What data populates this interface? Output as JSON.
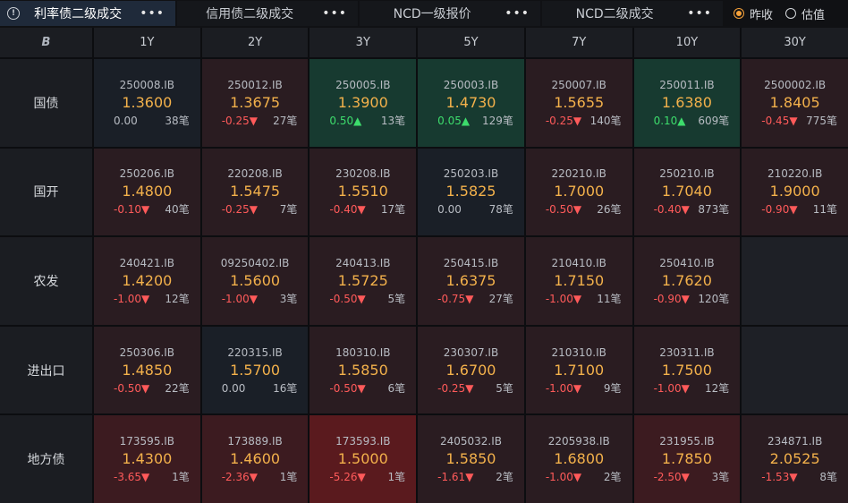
{
  "tabs": [
    {
      "label": "利率债二级成交",
      "active": true,
      "width": 196
    },
    {
      "label": "信用债二级成交",
      "active": false,
      "width": 202
    },
    {
      "label": "NCD一级报价",
      "active": false,
      "width": 202
    },
    {
      "label": "NCD二级成交",
      "active": false,
      "width": 202
    }
  ],
  "more_glyph": "•••",
  "corner_icon": "B",
  "radios": [
    {
      "label": "昨收",
      "checked": true
    },
    {
      "label": "估值",
      "checked": false
    }
  ],
  "columns": [
    "1Y",
    "2Y",
    "3Y",
    "5Y",
    "7Y",
    "10Y",
    "30Y"
  ],
  "rows": [
    {
      "label": "国债",
      "cells": [
        {
          "code": "250008.IB",
          "yield": "1.3600",
          "change": "0.00",
          "count": "38笔",
          "dir": "zero",
          "bg": "dark"
        },
        {
          "code": "250012.IB",
          "yield": "1.3675",
          "change": "-0.25▼",
          "count": "27笔",
          "dir": "neg",
          "bg": "red1"
        },
        {
          "code": "250005.IB",
          "yield": "1.3900",
          "change": "0.50▲",
          "count": "13笔",
          "dir": "pos",
          "bg": "green"
        },
        {
          "code": "250003.IB",
          "yield": "1.4730",
          "change": "0.05▲",
          "count": "129笔",
          "dir": "pos",
          "bg": "green"
        },
        {
          "code": "250007.IB",
          "yield": "1.5655",
          "change": "-0.25▼",
          "count": "140笔",
          "dir": "neg",
          "bg": "red1"
        },
        {
          "code": "250011.IB",
          "yield": "1.6380",
          "change": "0.10▲",
          "count": "609笔",
          "dir": "pos",
          "bg": "green"
        },
        {
          "code": "2500002.IB",
          "yield": "1.8405",
          "change": "-0.45▼",
          "count": "775笔",
          "dir": "neg",
          "bg": "red1"
        }
      ]
    },
    {
      "label": "国开",
      "cells": [
        {
          "code": "250206.IB",
          "yield": "1.4800",
          "change": "-0.10▼",
          "count": "40笔",
          "dir": "neg",
          "bg": "red1"
        },
        {
          "code": "220208.IB",
          "yield": "1.5475",
          "change": "-0.25▼",
          "count": "7笔",
          "dir": "neg",
          "bg": "red1"
        },
        {
          "code": "230208.IB",
          "yield": "1.5510",
          "change": "-0.40▼",
          "count": "17笔",
          "dir": "neg",
          "bg": "red1"
        },
        {
          "code": "250203.IB",
          "yield": "1.5825",
          "change": "0.00",
          "count": "78笔",
          "dir": "zero",
          "bg": "dark"
        },
        {
          "code": "220210.IB",
          "yield": "1.7000",
          "change": "-0.50▼",
          "count": "26笔",
          "dir": "neg",
          "bg": "red1"
        },
        {
          "code": "250210.IB",
          "yield": "1.7040",
          "change": "-0.40▼",
          "count": "873笔",
          "dir": "neg",
          "bg": "red1"
        },
        {
          "code": "210220.IB",
          "yield": "1.9000",
          "change": "-0.90▼",
          "count": "11笔",
          "dir": "neg",
          "bg": "red1"
        }
      ]
    },
    {
      "label": "农发",
      "cells": [
        {
          "code": "240421.IB",
          "yield": "1.4200",
          "change": "-1.00▼",
          "count": "12笔",
          "dir": "neg",
          "bg": "red1"
        },
        {
          "code": "09250402.IB",
          "yield": "1.5600",
          "change": "-1.00▼",
          "count": "3笔",
          "dir": "neg",
          "bg": "red1"
        },
        {
          "code": "240413.IB",
          "yield": "1.5725",
          "change": "-0.50▼",
          "count": "5笔",
          "dir": "neg",
          "bg": "red1"
        },
        {
          "code": "250415.IB",
          "yield": "1.6375",
          "change": "-0.75▼",
          "count": "27笔",
          "dir": "neg",
          "bg": "red1"
        },
        {
          "code": "210410.IB",
          "yield": "1.7150",
          "change": "-1.00▼",
          "count": "11笔",
          "dir": "neg",
          "bg": "red1"
        },
        {
          "code": "250410.IB",
          "yield": "1.7620",
          "change": "-0.90▼",
          "count": "120笔",
          "dir": "neg",
          "bg": "red1"
        },
        null
      ]
    },
    {
      "label": "进出口",
      "cells": [
        {
          "code": "250306.IB",
          "yield": "1.4850",
          "change": "-0.50▼",
          "count": "22笔",
          "dir": "neg",
          "bg": "red1"
        },
        {
          "code": "220315.IB",
          "yield": "1.5700",
          "change": "0.00",
          "count": "16笔",
          "dir": "zero",
          "bg": "dark"
        },
        {
          "code": "180310.IB",
          "yield": "1.5850",
          "change": "-0.50▼",
          "count": "6笔",
          "dir": "neg",
          "bg": "red1"
        },
        {
          "code": "230307.IB",
          "yield": "1.6700",
          "change": "-0.25▼",
          "count": "5笔",
          "dir": "neg",
          "bg": "red1"
        },
        {
          "code": "210310.IB",
          "yield": "1.7100",
          "change": "-1.00▼",
          "count": "9笔",
          "dir": "neg",
          "bg": "red1"
        },
        {
          "code": "230311.IB",
          "yield": "1.7500",
          "change": "-1.00▼",
          "count": "12笔",
          "dir": "neg",
          "bg": "red1"
        },
        null
      ]
    },
    {
      "label": "地方债",
      "cells": [
        {
          "code": "173595.IB",
          "yield": "1.4300",
          "change": "-3.65▼",
          "count": "1笔",
          "dir": "neg",
          "bg": "red2"
        },
        {
          "code": "173889.IB",
          "yield": "1.4600",
          "change": "-2.36▼",
          "count": "1笔",
          "dir": "neg",
          "bg": "red2"
        },
        {
          "code": "173593.IB",
          "yield": "1.5000",
          "change": "-5.26▼",
          "count": "1笔",
          "dir": "neg",
          "bg": "red3"
        },
        {
          "code": "2405032.IB",
          "yield": "1.5850",
          "change": "-1.61▼",
          "count": "2笔",
          "dir": "neg",
          "bg": "red1"
        },
        {
          "code": "2205938.IB",
          "yield": "1.6800",
          "change": "-1.00▼",
          "count": "2笔",
          "dir": "neg",
          "bg": "red1"
        },
        {
          "code": "231955.IB",
          "yield": "1.7850",
          "change": "-2.50▼",
          "count": "3笔",
          "dir": "neg",
          "bg": "red2"
        },
        {
          "code": "234871.IB",
          "yield": "2.0525",
          "change": "-1.53▼",
          "count": "8笔",
          "dir": "neg",
          "bg": "red1"
        }
      ]
    }
  ]
}
